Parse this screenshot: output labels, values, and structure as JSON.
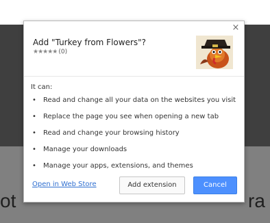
{
  "dialog": {
    "title": "Add \"Turkey from Flowers\"?",
    "rating_stars": "★★★★★",
    "rating_count": "(0)",
    "it_can": "It can:",
    "permissions": [
      "Read and change all your data on the websites you visit",
      "Replace the page you see when opening a new tab",
      "Read and change your browsing history",
      "Manage your downloads",
      "Manage your apps, extensions, and themes"
    ],
    "bullet": "•",
    "close": "×",
    "link": "Open in Web Store",
    "add_button": "Add extension",
    "cancel_button": "Cancel",
    "icon": "turkey-pilgrim-icon"
  },
  "background": {
    "left_text": "ot",
    "right_text": "ra"
  },
  "colors": {
    "accent": "#4d90fe",
    "link": "#2f6fd0",
    "background_dark": "#3f3f3f",
    "background_grey": "#808080"
  }
}
